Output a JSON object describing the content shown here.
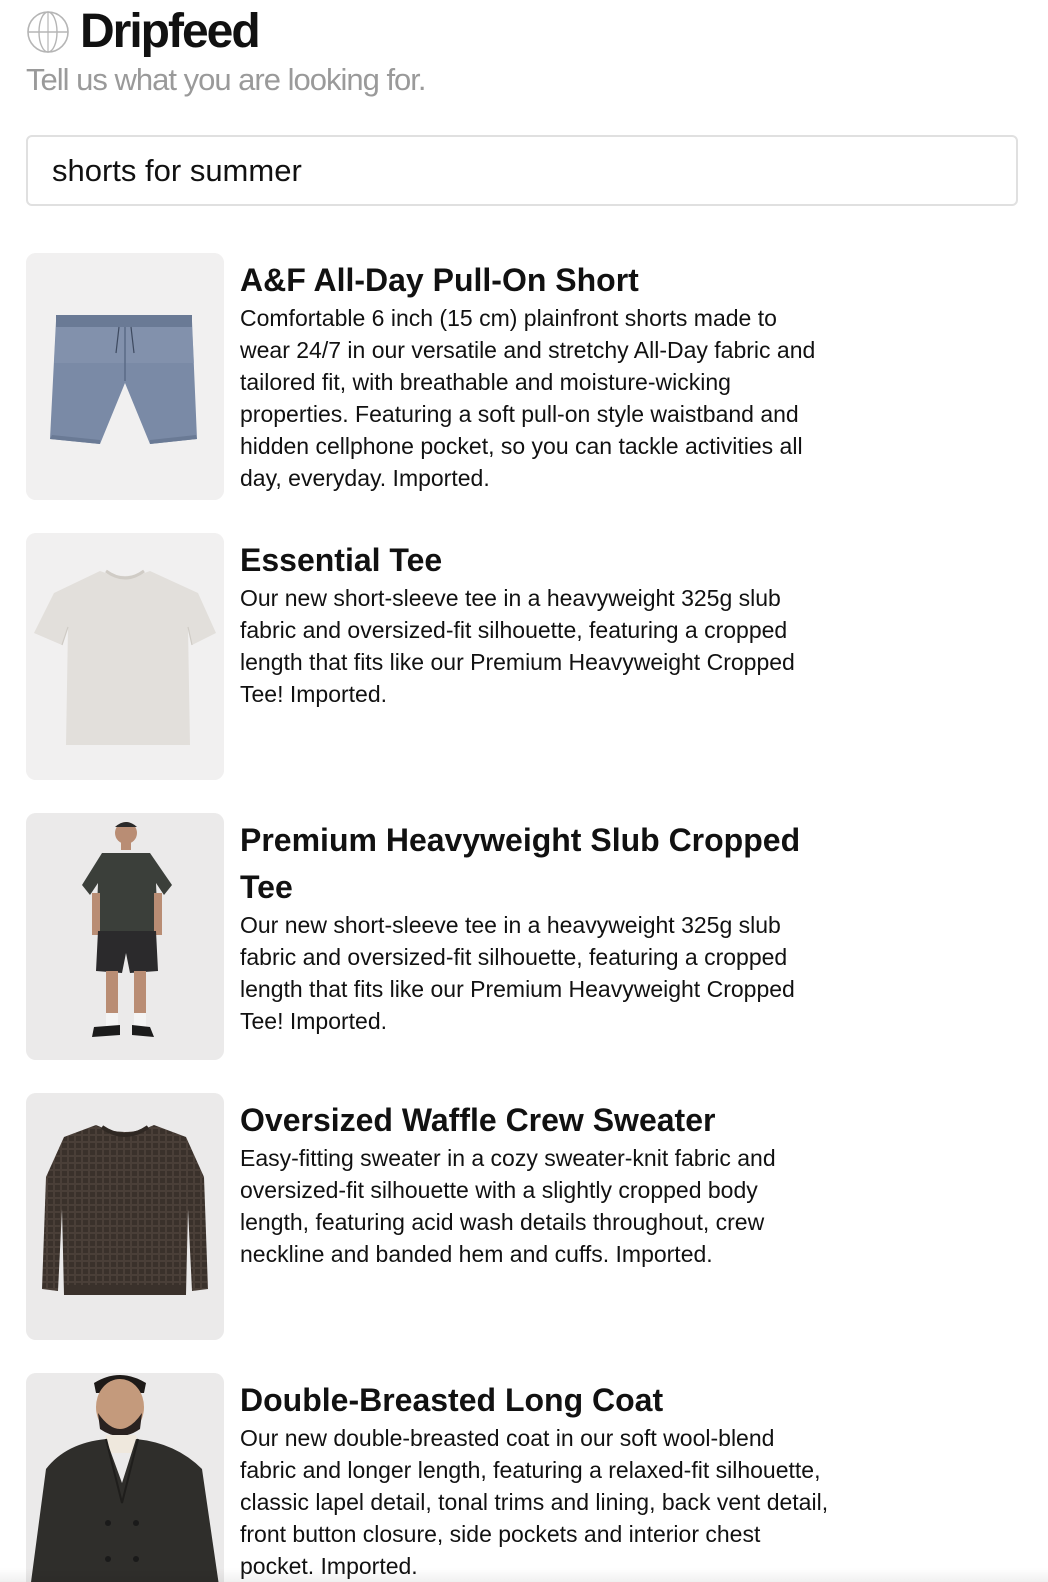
{
  "app": {
    "name": "Dripfeed",
    "logo_icon": "globe-icon",
    "tagline": "Tell us what you are looking for."
  },
  "search": {
    "value": "shorts for summer"
  },
  "results": [
    {
      "title": "A&F All-Day Pull-On Short",
      "description": "Comfortable 6 inch (15 cm) plainfront shorts made to wear 24/7 in our versatile and stretchy All-Day fabric and tailored fit, with breathable and moisture-wicking properties. Featuring a soft pull-on style waistband and hidden cellphone pocket, so you can tackle activities all day, everyday. Imported.",
      "image": "blue-shorts-image"
    },
    {
      "title": "Essential Tee",
      "description": "Our new short-sleeve tee in a heavyweight 325g slub fabric and oversized-fit silhouette, featuring a cropped length that fits like our Premium Heavyweight Cropped Tee! Imported.",
      "image": "white-tee-image"
    },
    {
      "title": "Premium Heavyweight Slub Cropped Tee",
      "description": "Our new short-sleeve tee in a heavyweight 325g slub fabric and oversized-fit silhouette, featuring a cropped length that fits like our Premium Heavyweight Cropped Tee! Imported.",
      "image": "model-cropped-tee-image"
    },
    {
      "title": "Oversized Waffle Crew Sweater",
      "description": "Easy-fitting sweater in a cozy sweater-knit fabric and oversized-fit silhouette with a slightly cropped body length, featuring acid wash details throughout, crew neckline and banded hem and cuffs. Imported.",
      "image": "brown-sweater-image"
    },
    {
      "title": "Double-Breasted Long Coat",
      "description": "Our new double-breasted coat in our soft wool-blend fabric and longer length, featuring a relaxed-fit silhouette, classic lapel detail, tonal trims and lining, back vent detail, front button closure, side pockets and interior chest pocket. Imported.",
      "image": "model-long-coat-image"
    }
  ]
}
